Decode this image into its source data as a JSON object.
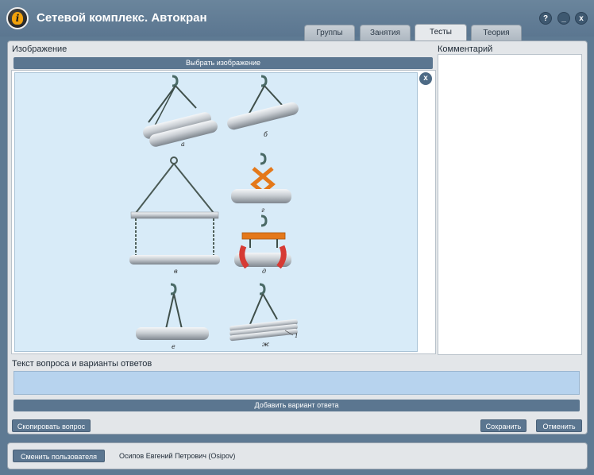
{
  "app": {
    "title": "Сетевой комплекс. Автокран"
  },
  "window_buttons": {
    "help": "?",
    "minimize": "_",
    "close": "x"
  },
  "tabs": [
    {
      "label": "Группы",
      "active": false
    },
    {
      "label": "Занятия",
      "active": false
    },
    {
      "label": "Тесты",
      "active": true
    },
    {
      "label": "Теория",
      "active": false
    }
  ],
  "image_section": {
    "label": "Изображение",
    "select_button": "Выбрать изображение",
    "remove_button": "x",
    "figure_labels": {
      "a": "а",
      "b": "б",
      "v": "в",
      "g": "г",
      "d": "д",
      "e": "е",
      "zh": "ж",
      "one": "1"
    }
  },
  "comment_section": {
    "label": "Комментарий",
    "value": ""
  },
  "question_section": {
    "label": "Текст вопроса и варианты ответов",
    "value": "",
    "add_answer_button": "Добавить вариант ответа"
  },
  "actions": {
    "copy_question": "Скопировать вопрос",
    "save": "Сохранить",
    "cancel": "Отменить"
  },
  "footer": {
    "change_user": "Сменить пользователя",
    "user_name": "Осипов Евгений Петрович (Osipov)"
  },
  "colors": {
    "background": "#5e7a93",
    "panel": "#e3e6e9",
    "button": "#5b7690",
    "image_bg": "#d8ebf8",
    "question_bg": "#b7d3ee"
  }
}
